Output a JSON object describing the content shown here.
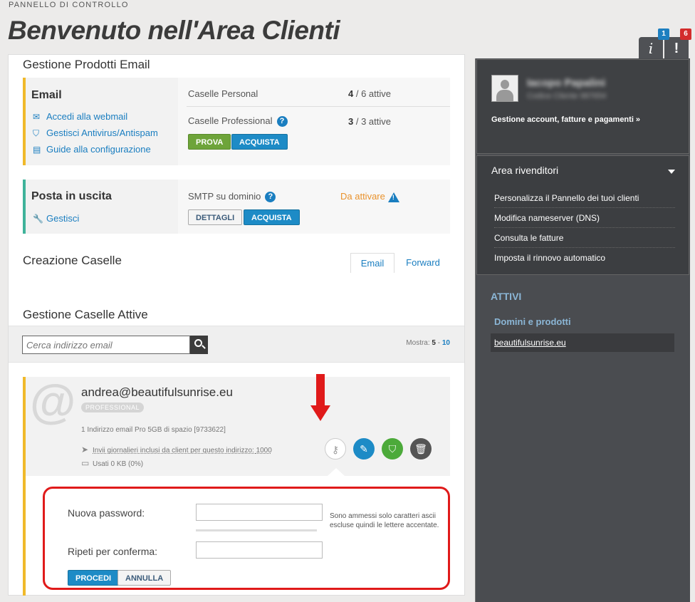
{
  "header": {
    "kicker": "PANNELLO DI CONTROLLO",
    "title": "Benvenuto nell'Area Clienti",
    "notifications": {
      "info_count": "1",
      "alert_count": "6",
      "info_glyph": "i",
      "alert_glyph": "!"
    }
  },
  "email_products": {
    "section_title": "Gestione Prodotti Email",
    "email_card": {
      "title": "Email",
      "links": [
        "Accedi alla webmail",
        "Gestisci Antivirus/Antispam",
        "Guide alla configurazione"
      ],
      "personal_label": "Caselle Personal",
      "personal_value": "4",
      "personal_suffix": " / 6 attive",
      "professional_label": "Caselle Professional",
      "professional_value": "3",
      "professional_suffix": " / 3 attive",
      "try_label": "PROVA",
      "buy_label": "ACQUISTA"
    },
    "outgoing_card": {
      "title": "Posta in uscita",
      "link": "Gestisci",
      "smtp_label": "SMTP su dominio",
      "status": "Da attivare",
      "details_label": "DETTAGLI",
      "buy_label": "ACQUISTA"
    }
  },
  "creation": {
    "section_title": "Creazione Caselle",
    "tabs": [
      "Email",
      "Forward"
    ]
  },
  "active": {
    "section_title": "Gestione Caselle Attive",
    "search_placeholder": "Cerca indirizzo email",
    "show_label": "Mostra: ",
    "show_current": "5",
    "show_sep": " - ",
    "show_other": "10"
  },
  "mailbox": {
    "email": "andrea@beautifulsunrise.eu",
    "badge": "PROFESSIONAL",
    "info": "1 Indirizzo email Pro 5GB di spazio [9733622]",
    "daily_label": "Invii giornalieri inclusi da client per questo indirizzo: ",
    "daily_value": "1000",
    "usage": "Usati 0 KB (0%)"
  },
  "password_form": {
    "new_label": "Nuova password:",
    "repeat_label": "Ripeti per conferma:",
    "hint_line1": "Sono ammessi solo caratteri ascii",
    "hint_line2": "escluse quindi le lettere accentate.",
    "proceed_label": "PROCEDI",
    "cancel_label": "ANNULLA"
  },
  "sidebar": {
    "user_name": "Iacopo Papalini",
    "user_sub": "Codice Cliente 987654",
    "account_link": "Gestione account, fatture e pagamenti »",
    "reseller_title": "Area rivenditori",
    "reseller_items": [
      "Personalizza il Pannello dei tuoi clienti",
      "Modifica nameserver (DNS)",
      "Consulta le fatture",
      "Imposta il rinnovo automatico"
    ],
    "active_title": "ATTIVI",
    "domains_title": "Domini e prodotti",
    "domain": "beautifulsunrise.eu"
  },
  "colors": {
    "email_accent": "#f0b92a",
    "outgoing_accent": "#3fb39a",
    "link": "#1a7ec0",
    "highlight": "#e01a1a",
    "sidebar_bg": "#4a4c50"
  }
}
